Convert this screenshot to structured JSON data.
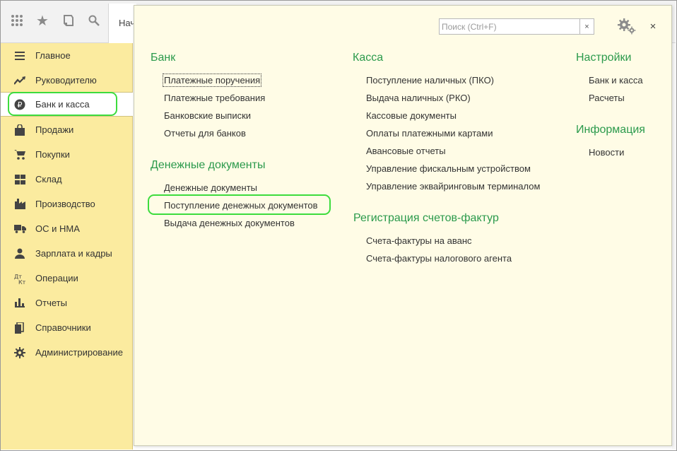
{
  "toolbar": {
    "icons": [
      "apps-grid-icon",
      "star-icon",
      "history-icon",
      "search-icon"
    ],
    "tab_label": "Нач"
  },
  "sidebar": {
    "items": [
      {
        "label": "Главное",
        "icon": "menu-lines-icon"
      },
      {
        "label": "Руководителю",
        "icon": "trend-up-icon"
      },
      {
        "label": "Банк и касса",
        "icon": "ruble-icon"
      },
      {
        "label": "Продажи",
        "icon": "shopping-bag-icon"
      },
      {
        "label": "Покупки",
        "icon": "cart-icon"
      },
      {
        "label": "Склад",
        "icon": "warehouse-icon"
      },
      {
        "label": "Производство",
        "icon": "factory-icon"
      },
      {
        "label": "ОС и НМА",
        "icon": "truck-icon"
      },
      {
        "label": "Зарплата и кадры",
        "icon": "person-icon"
      },
      {
        "label": "Операции",
        "icon": "dt-kt-icon"
      },
      {
        "label": "Отчеты",
        "icon": "bar-chart-icon"
      },
      {
        "label": "Справочники",
        "icon": "books-icon"
      },
      {
        "label": "Администрирование",
        "icon": "gear-icon"
      }
    ],
    "active_index": 2
  },
  "panel": {
    "search_placeholder": "Поиск (Ctrl+F)",
    "clear_label": "×",
    "close_label": "×",
    "sections": {
      "bank": {
        "title": "Банк",
        "links": [
          "Платежные поручения",
          "Платежные требования",
          "Банковские выписки",
          "Отчеты для банков"
        ]
      },
      "money_docs": {
        "title": "Денежные документы",
        "links": [
          "Денежные документы",
          "Поступление денежных документов",
          "Выдача денежных документов"
        ]
      },
      "kassa": {
        "title": "Касса",
        "links": [
          "Поступление наличных (ПКО)",
          "Выдача наличных (РКО)",
          "Кассовые документы",
          "Оплаты платежными картами",
          "Авансовые отчеты",
          "Управление фискальным устройством",
          "Управление эквайринговым терминалом"
        ]
      },
      "invoices": {
        "title": "Регистрация счетов-фактур",
        "links": [
          "Счета-фактуры на аванс",
          "Счета-фактуры налогового агента"
        ]
      },
      "settings": {
        "title": "Настройки",
        "links": [
          "Банк и касса",
          "Расчеты"
        ]
      },
      "info": {
        "title": "Информация",
        "links": [
          "Новости"
        ]
      }
    }
  },
  "colors": {
    "sidebar_bg": "#fbeb9f",
    "panel_bg": "#fffce6",
    "section_title": "#2b9a4c",
    "highlight": "#3ddc3d"
  }
}
